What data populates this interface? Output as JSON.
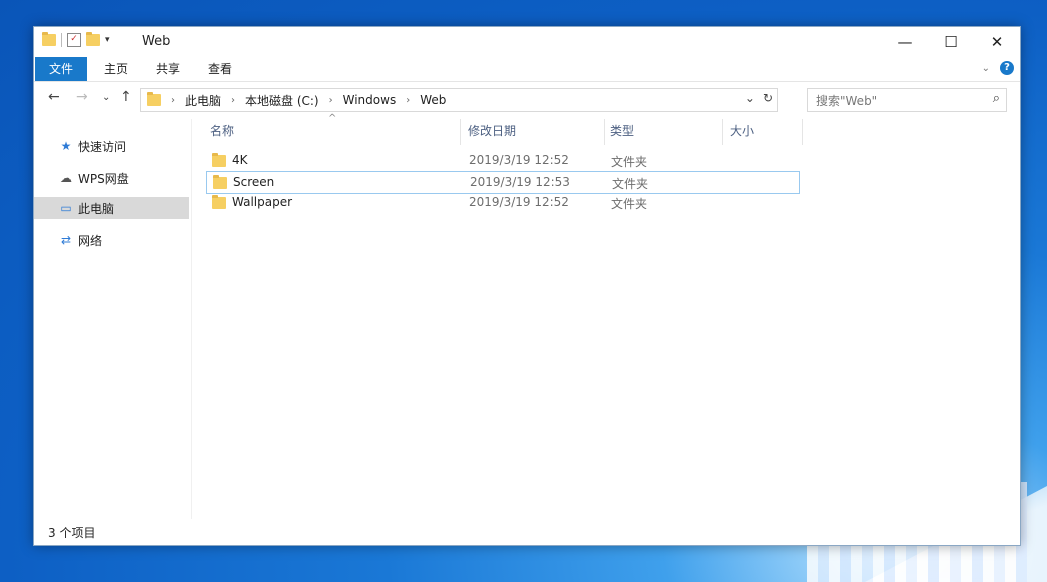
{
  "window": {
    "title": "Web"
  },
  "ribbon": {
    "tabs": [
      "文件",
      "主页",
      "共享",
      "查看"
    ]
  },
  "address": {
    "crumbs": [
      "此电脑",
      "本地磁盘 (C:)",
      "Windows",
      "Web"
    ]
  },
  "search": {
    "placeholder": "搜索\"Web\""
  },
  "sidebar": {
    "items": [
      {
        "label": "快速访问",
        "icon": "star-icon"
      },
      {
        "label": "WPS网盘",
        "icon": "cloud-icon"
      },
      {
        "label": "此电脑",
        "icon": "computer-icon"
      },
      {
        "label": "网络",
        "icon": "network-icon"
      }
    ]
  },
  "columns": [
    "名称",
    "修改日期",
    "类型",
    "大小"
  ],
  "files": [
    {
      "name": "4K",
      "date": "2019/3/19 12:52",
      "type": "文件夹"
    },
    {
      "name": "Screen",
      "date": "2019/3/19 12:53",
      "type": "文件夹"
    },
    {
      "name": "Wallpaper",
      "date": "2019/3/19 12:52",
      "type": "文件夹"
    }
  ],
  "status": {
    "count": "3 个项目"
  },
  "colors": {
    "accent": "#1979ca",
    "folder": "#f6cf62",
    "selection_border": "#99c9ef"
  }
}
